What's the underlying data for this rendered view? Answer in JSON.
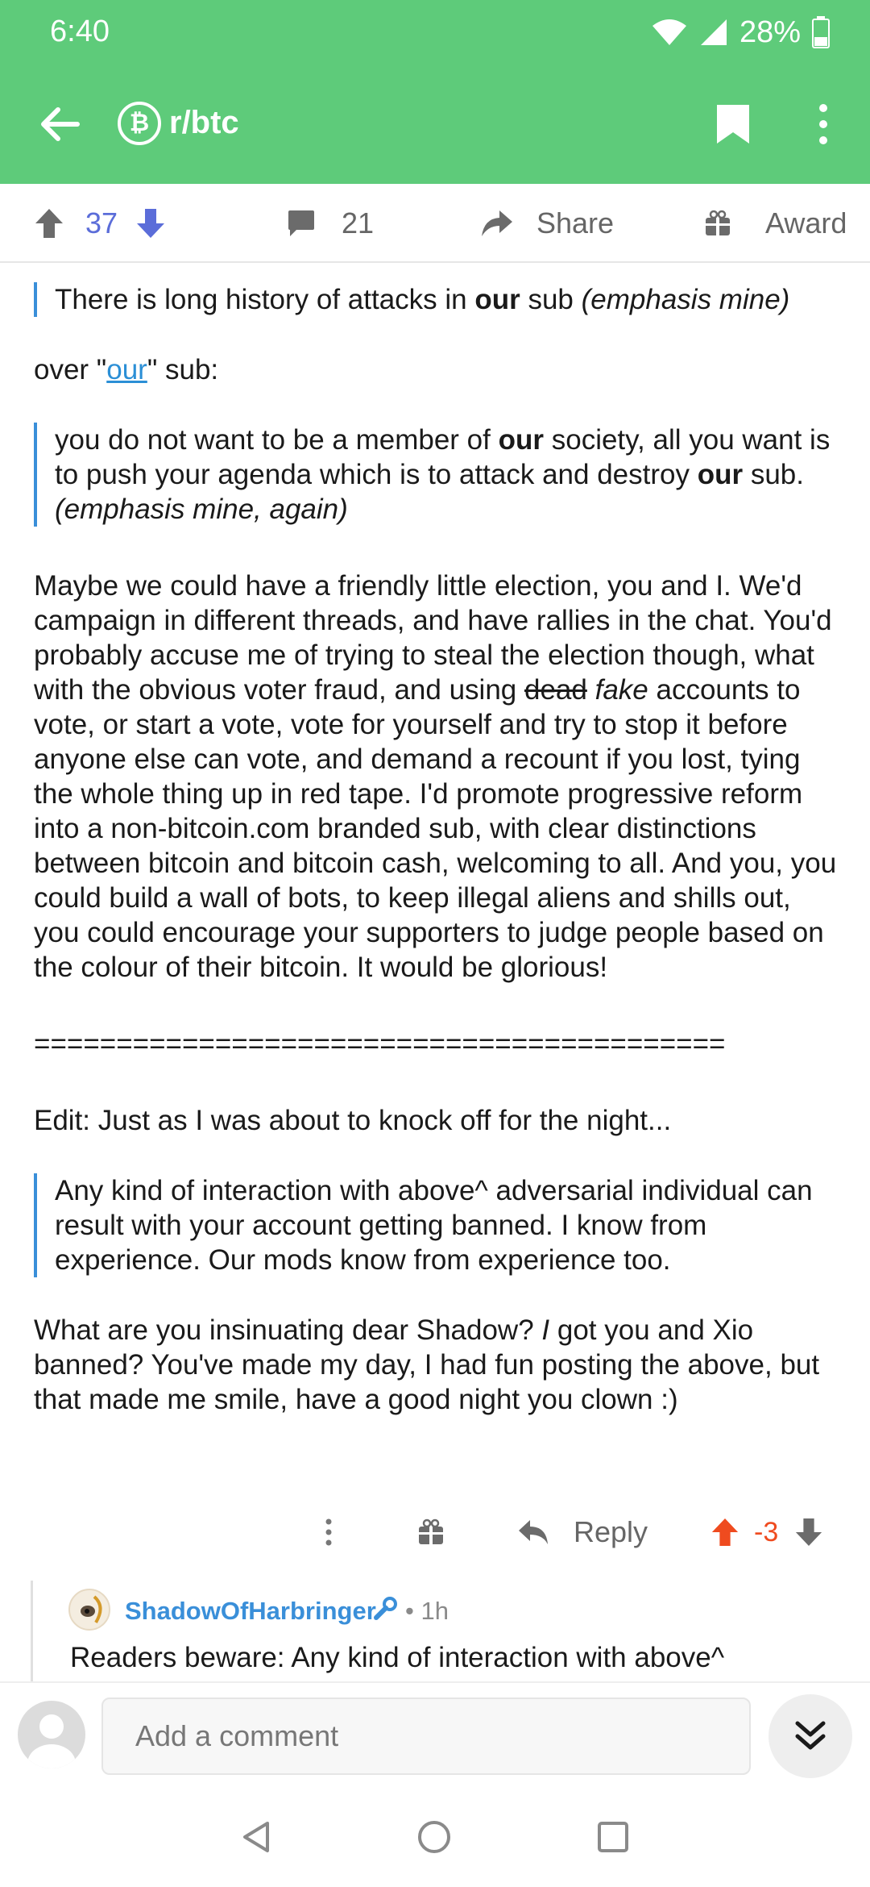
{
  "status_bar": {
    "time": "6:40",
    "battery": "28%"
  },
  "toolbar": {
    "subreddit": "r/btc",
    "subreddit_icon": "bitcoin-icon"
  },
  "post_actions": {
    "score": "37",
    "comments": "21",
    "share_label": "Share",
    "award_label": "Award"
  },
  "comment": {
    "q1": {
      "pre": "There is long history of attacks in ",
      "bold": "our",
      "mid": " sub ",
      "italic": "(emphasis mine)"
    },
    "p_over": {
      "pre": "over \"",
      "link": "our",
      "post": "\" sub:"
    },
    "q2": {
      "a": "you do not want to be a member of ",
      "b1": "our",
      "c": " society, all you want is to push your agenda which is to attack and destroy ",
      "b2": "our",
      "d": " sub. ",
      "italic": "(emphasis mine, again)"
    },
    "p_election": {
      "a": "Maybe we could have a friendly little election, you and I. We'd campaign in different threads, and have rallies in the chat. You'd probably accuse me of trying to steal the election though, what with the obvious voter fraud, and using ",
      "strike": "dead",
      "space": " ",
      "italic": "fake",
      "b": " accounts to vote, or start a vote, vote for yourself and try to stop it before anyone else can vote, and demand a recount if you lost, tying the whole thing up in red tape.  I'd promote progressive reform into a non-bitcoin.com branded sub, with clear distinctions between bitcoin and bitcoin cash, welcoming to all.  And you, you could build a wall of bots, to keep illegal aliens and shills out, you could encourage your supporters to judge people based on the colour of their bitcoin. It would be glorious!"
    },
    "separator": "===========================================",
    "p_edit": "Edit: Just as I was about to knock off for the night...",
    "q3": "Any kind of interaction with above^ adversarial individual can result with your account getting banned. I know from experience. Our mods know from experience too.",
    "p_final": {
      "a": "What are you insinuating dear Shadow?  ",
      "italic": "I",
      "b": " got you and Xio banned?  You've made my day, I had fun posting the above, but that made me smile, have a good night you clown :)"
    }
  },
  "comment_actions": {
    "reply_label": "Reply",
    "score": "-3"
  },
  "reply": {
    "username": "ShadowOfHarbringer",
    "time": "• 1h",
    "text": "Readers beware: Any kind of interaction with above^"
  },
  "bottom": {
    "placeholder": "Add a comment"
  },
  "colors": {
    "appbar": "#5ecb7a",
    "upvote": "#5b6dd9",
    "downvote_negative": "#ef4b1f",
    "link": "#2b8fd6"
  }
}
